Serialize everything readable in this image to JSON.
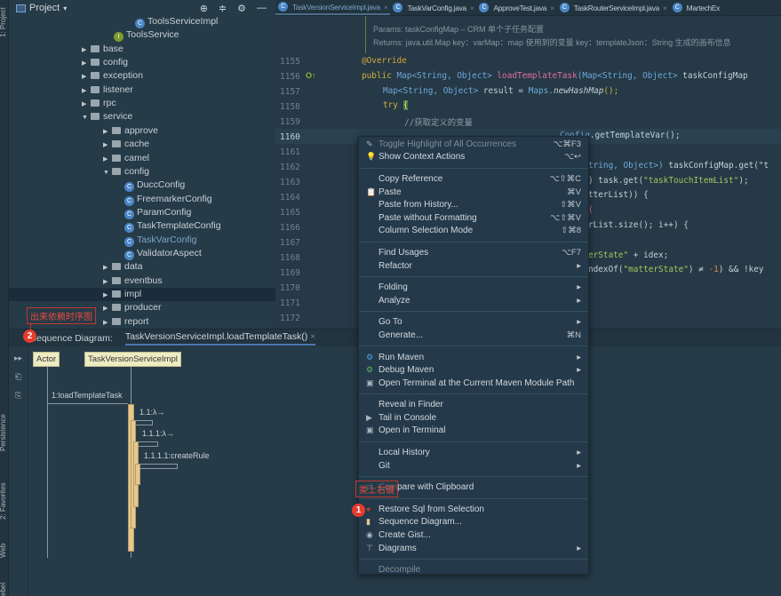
{
  "sidebar": {
    "tabs": [
      "1: Project",
      "Persistence",
      "2: Favorites",
      "Web",
      "ebel"
    ]
  },
  "project": {
    "title": "Project",
    "rows": [
      {
        "label": "ToolsServiceImpl",
        "kind": "class",
        "indent": 12
      },
      {
        "label": "ToolsService",
        "kind": "interface",
        "indent": 10
      },
      {
        "label": "base",
        "kind": "folder",
        "indent": 7,
        "expanded": false
      },
      {
        "label": "config",
        "kind": "folder",
        "indent": 7,
        "expanded": false
      },
      {
        "label": "exception",
        "kind": "folder",
        "indent": 7,
        "expanded": false
      },
      {
        "label": "listener",
        "kind": "folder",
        "indent": 7,
        "expanded": false
      },
      {
        "label": "rpc",
        "kind": "folder",
        "indent": 7,
        "expanded": false
      },
      {
        "label": "service",
        "kind": "folder",
        "indent": 7,
        "expanded": true
      },
      {
        "label": "approve",
        "kind": "folder",
        "indent": 9,
        "expanded": false
      },
      {
        "label": "cache",
        "kind": "folder",
        "indent": 9,
        "expanded": false
      },
      {
        "label": "camel",
        "kind": "folder",
        "indent": 9,
        "expanded": false
      },
      {
        "label": "config",
        "kind": "folder",
        "indent": 9,
        "expanded": true
      },
      {
        "label": "DuccConfig",
        "kind": "class",
        "indent": 11
      },
      {
        "label": "FreemarkerConfig",
        "kind": "class",
        "indent": 11
      },
      {
        "label": "ParamConfig",
        "kind": "class",
        "indent": 11
      },
      {
        "label": "TaskTemplateConfig",
        "kind": "class",
        "indent": 11
      },
      {
        "label": "TaskVarConfig",
        "kind": "class",
        "indent": 11,
        "highlight": true
      },
      {
        "label": "ValidatorAspect",
        "kind": "class",
        "indent": 11
      },
      {
        "label": "data",
        "kind": "folder",
        "indent": 9,
        "expanded": false
      },
      {
        "label": "eventbus",
        "kind": "folder",
        "indent": 9,
        "expanded": false
      },
      {
        "label": "impl",
        "kind": "folder",
        "indent": 9,
        "expanded": false,
        "selected": true
      },
      {
        "label": "producer",
        "kind": "folder",
        "indent": 9,
        "expanded": false
      },
      {
        "label": "report",
        "kind": "folder",
        "indent": 9,
        "expanded": false
      }
    ]
  },
  "editor": {
    "tabs": [
      {
        "label": "TaskVersionServiceImpl.java",
        "active": true
      },
      {
        "label": "TaskVarConfig.java"
      },
      {
        "label": "ApproveTest.java"
      },
      {
        "label": "TaskRouterServiceImpl.java"
      },
      {
        "label": "MartechEx"
      }
    ],
    "doc": [
      "Params: taskConfigMap – CRM 单个子任务配置",
      "Returns: java.util.Map key：varMap：map 使用到的变量 key：templateJson：String 生成的画布信息"
    ],
    "line_numbers": [
      "1155",
      "1156",
      "1157",
      "1158",
      "1159",
      "1160",
      "1161",
      "1162",
      "1163",
      "1164",
      "1165",
      "1166",
      "1167",
      "1168",
      "1169",
      "1170",
      "1171",
      "1172"
    ],
    "code": {
      "l1155": "@Override",
      "l1156a": "public ",
      "l1156b": "Map<String, Object> ",
      "l1156c": "loadTemplateTask",
      "l1156d": "(Map<String, Object> ",
      "l1156e": "taskConfigMap",
      "l1157a": "Map<String, Object> ",
      "l1157b": "result = ",
      "l1157c": "Maps.",
      "l1157d": "newHashMap",
      "l1157e": "();",
      "l1158a": "try ",
      "l1158b": "{",
      "l1159": "//获取定义的变量",
      "l1160a": "Config",
      "l1160b": ".getTemplateVar();",
      "l1162a": "tring, Object>) ",
      "l1162b": "taskConfigMap.get(\"t",
      "l1163a": ") task.get(",
      "l1163b": "\"taskTouchItemList\"",
      "l1163c": ");",
      "l1164": "tterList)) {",
      "l1165": "(",
      "l1166": "rList.size(); i++) {",
      "l1168a": "erState\"",
      "l1168b": " + idex;",
      "l1169a": "ndexOf(",
      "l1169b": "\"matterState\"",
      "l1169c": ") ≠ ",
      "l1169d": "-1",
      ") && !key": "",
      "l1169e": ") && !key"
    }
  },
  "bottom": {
    "label": "Sequence Diagram:",
    "tab": "TaskVersionServiceImpl.loadTemplateTask()"
  },
  "diagram": {
    "lifelines": [
      "Actor",
      "TaskVersionServiceImpl"
    ],
    "messages": [
      "1:loadTemplateTask",
      "1.1:λ→",
      "1.1.1:λ→",
      "1.1.1.1:createRule"
    ]
  },
  "menu": [
    {
      "label": "Toggle Highlight of All Occurrences",
      "shortcut": "⌥⌘F3",
      "icon": "highlighter-icon",
      "disabled": true
    },
    {
      "label": "Show Context Actions",
      "shortcut": "⌥↩",
      "icon": "lightbulb-icon"
    },
    {
      "sep": true
    },
    {
      "label": "Copy Reference",
      "shortcut": "⌥⇧⌘C"
    },
    {
      "label": "Paste",
      "shortcut": "⌘V",
      "icon": "clipboard-icon"
    },
    {
      "label": "Paste from History...",
      "shortcut": "⇧⌘V"
    },
    {
      "label": "Paste without Formatting",
      "shortcut": "⌥⇧⌘V"
    },
    {
      "label": "Column Selection Mode",
      "shortcut": "⇧⌘8"
    },
    {
      "sep": true
    },
    {
      "label": "Find Usages",
      "shortcut": "⌥F7"
    },
    {
      "label": "Refactor",
      "submenu": true
    },
    {
      "sep": true
    },
    {
      "label": "Folding",
      "submenu": true
    },
    {
      "label": "Analyze",
      "submenu": true
    },
    {
      "sep": true
    },
    {
      "label": "Go To",
      "submenu": true
    },
    {
      "label": "Generate...",
      "shortcut": "⌘N"
    },
    {
      "sep": true
    },
    {
      "label": "Run Maven",
      "submenu": true,
      "icon": "maven-run-icon"
    },
    {
      "label": "Debug Maven",
      "submenu": true,
      "icon": "maven-debug-icon"
    },
    {
      "label": "Open Terminal at the Current Maven Module Path",
      "icon": "terminal-icon"
    },
    {
      "sep": true
    },
    {
      "label": "Reveal in Finder"
    },
    {
      "label": "Tail in Console",
      "icon": "play-icon"
    },
    {
      "label": "Open in Terminal",
      "icon": "terminal-icon"
    },
    {
      "sep": true
    },
    {
      "label": "Local History",
      "submenu": true
    },
    {
      "label": "Git",
      "submenu": true
    },
    {
      "sep": true
    },
    {
      "label": "Compare with Clipboard",
      "icon": "compare-icon"
    },
    {
      "sep": true
    },
    {
      "label": "Restore Sql from Selection",
      "icon": "sql-icon"
    },
    {
      "label": "Sequence Diagram...",
      "icon": "sequence-diagram-icon"
    },
    {
      "label": "Create Gist...",
      "icon": "github-icon"
    },
    {
      "label": "Diagrams",
      "submenu": true,
      "icon": "diagrams-icon"
    },
    {
      "sep": true
    },
    {
      "label": "Decompile",
      "disabled": true
    }
  ],
  "annotations": {
    "callout1": "类上右键",
    "badge1": "1",
    "callout2": "出来依赖时序图",
    "badge2": "2"
  },
  "colors": {
    "accent": "#4a78b0",
    "annotation": "#e53c2e",
    "lifeline_box": "#ecebc2",
    "activation": "#e5c88e"
  }
}
